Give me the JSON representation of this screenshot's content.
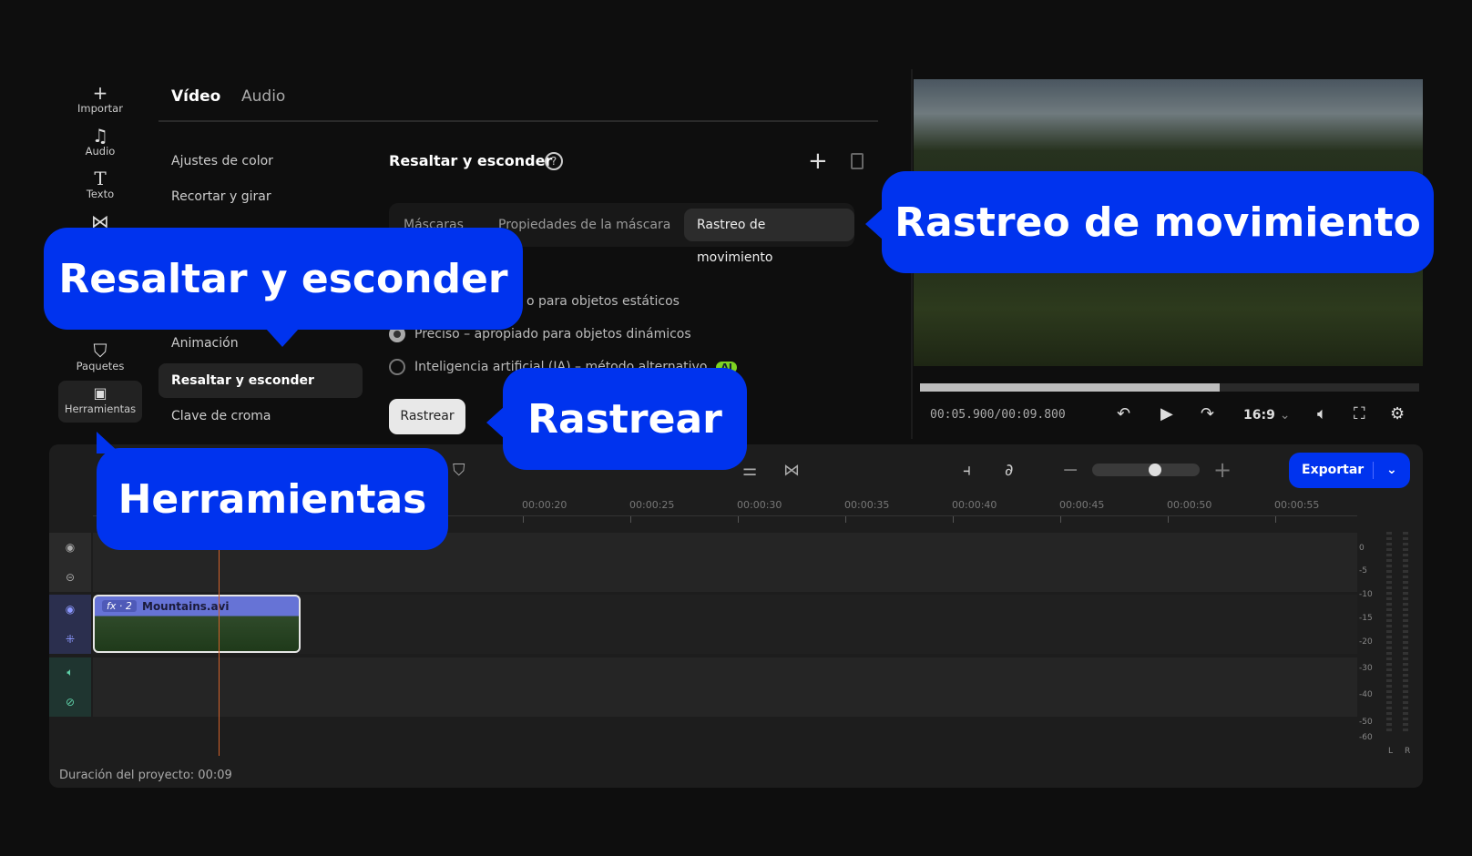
{
  "sidebar": {
    "items": [
      {
        "label": "Importar",
        "icon": "plus-icon"
      },
      {
        "label": "Audio",
        "icon": "music-note-icon"
      },
      {
        "label": "Texto",
        "icon": "text-icon"
      },
      {
        "label": "",
        "icon": "transitions-icon"
      },
      {
        "label": "Paquetes",
        "icon": "package-icon"
      },
      {
        "label": "Herramientas",
        "icon": "tools-grid-icon"
      }
    ]
  },
  "tabs": {
    "video": "Vídeo",
    "audio": "Audio"
  },
  "menu": [
    "Ajustes de color",
    "Recortar y girar",
    "Animación",
    "Resaltar y esconder",
    "Clave de croma"
  ],
  "panel": {
    "title": "Resaltar y esconder",
    "segments": [
      "Máscaras",
      "Propiedades de la máscara",
      "Rastreo de movimiento"
    ],
    "radios": [
      "o para objetos estáticos",
      "Preciso – apropiado para objetos dinámicos",
      "Inteligencia artificial (IA) – método alternativo"
    ],
    "ai_badge": "AI",
    "track_button": "Rastrear"
  },
  "player": {
    "time": "00:05.900/00:09.800",
    "progress": 0.6,
    "ratio": "16:9"
  },
  "timeline": {
    "export": "Exportar",
    "zoom_level": 0.6,
    "ticks": [
      "00:00:20",
      "00:00:25",
      "00:00:30",
      "00:00:35",
      "00:00:40",
      "00:00:45",
      "00:00:50",
      "00:00:55"
    ],
    "clip": {
      "fx": "fx · 2",
      "name": "Mountains.avi"
    },
    "db_scale": [
      "0",
      "-5",
      "-10",
      "-15",
      "-20",
      "-30",
      "-40",
      "-50",
      "-60"
    ],
    "lr": [
      "L",
      "R"
    ],
    "duration": "Duración del proyecto: 00:09"
  },
  "callouts": {
    "highlight": "Resaltar y esconder",
    "tracking": "Rastreo de movimiento",
    "track": "Rastrear",
    "tools": "Herramientas"
  },
  "colors": {
    "accent": "#0033ee",
    "clip": "#6673d6",
    "ai": "#7ed321"
  }
}
